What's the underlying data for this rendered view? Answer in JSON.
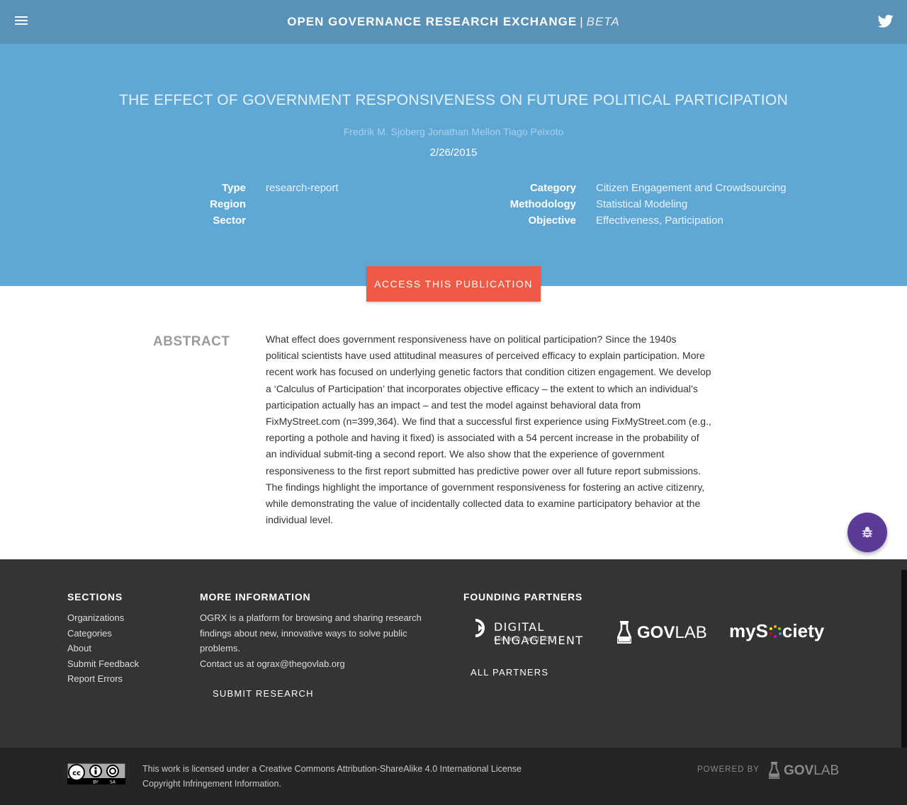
{
  "header": {
    "brand": "OPEN GOVERNANCE RESEARCH EXCHANGE",
    "separator": "|",
    "beta": "BETA",
    "menu_icon": "hamburger-menu-icon",
    "twitter_icon": "twitter-icon"
  },
  "publication": {
    "title": "THE EFFECT OF GOVERNMENT RESPONSIVENESS ON FUTURE POLITICAL PARTICIPATION",
    "authors": "Fredrik M. Sjoberg Jonathan Mellon Tiago Peixoto",
    "date": "2/26/2015",
    "left_meta": [
      {
        "label": "Type",
        "value": "research-report"
      },
      {
        "label": "Region",
        "value": ""
      },
      {
        "label": "Sector",
        "value": ""
      }
    ],
    "right_meta": [
      {
        "label": "Category",
        "value": "Citizen Engagement and Crowdsourcing"
      },
      {
        "label": "Methodology",
        "value": "Statistical Modeling"
      },
      {
        "label": "Objective",
        "value": "Effectiveness, Participation"
      }
    ],
    "access_button": "ACCESS THIS PUBLICATION"
  },
  "abstract": {
    "heading": "ABSTRACT",
    "text": "What effect does government responsiveness have on political participation? Since the 1940s political scientists have used attitudinal measures of perceived efficacy to explain participation. More recent work has focused on underlying genetic factors that condition citizen engagement. We develop a ‘Calculus of Participation’ that incorporates objective efficacy – the extent to which an individual’s participation actually has an impact – and test the model against behavioral data from FixMyStreet.com (n=399,364). We find that a successful first experience using FixMyStreet.com (e.g., reporting a pothole and having it fixed) is associated with a 54 percent increase in the probability of an individual submit-ting a second report. We also show that the experience of government responsiveness to the first report submitted has predictive power over all future report submissions. The findings highlight the importance of government responsiveness for fostering an active citizenry, while demonstrating the value of incidentally collected data to examine participatory behavior at the individual level."
  },
  "fab": {
    "icon": "bug-icon"
  },
  "footer": {
    "sections_heading": "SECTIONS",
    "sections": [
      "Organizations",
      "Categories",
      "About",
      "Submit Feedback",
      "Report Errors"
    ],
    "more_heading": "MORE INFORMATION",
    "more_text": "OGRX is a platform for browsing and sharing research findings about new, innovative ways to solve public problems.",
    "contact": "Contact us at ograx@thegovlab.org",
    "submit_research": "SUBMIT RESEARCH",
    "partners_heading": "FOUNDING PARTNERS",
    "partners": {
      "digital_engagement": "DIGITAL ENGAGEMENT",
      "digital_engagement_sub": "Evaluation Team | DEET",
      "govlab_bold": "GOV",
      "govlab_light": "LAB",
      "mysociety_pre": "myS",
      "mysociety_post": "ciety"
    },
    "all_partners": "ALL PARTNERS"
  },
  "bottom": {
    "license": "This work is licensed under a Creative Commons Attribution-ShareAlike 4.0 International License",
    "copyright": "Copyright Infringement Information.",
    "powered_by": "POWERED BY",
    "govlab_bold": "GOV",
    "govlab_light": "LAB",
    "cc_icon": "cc-by-sa-icon"
  }
}
